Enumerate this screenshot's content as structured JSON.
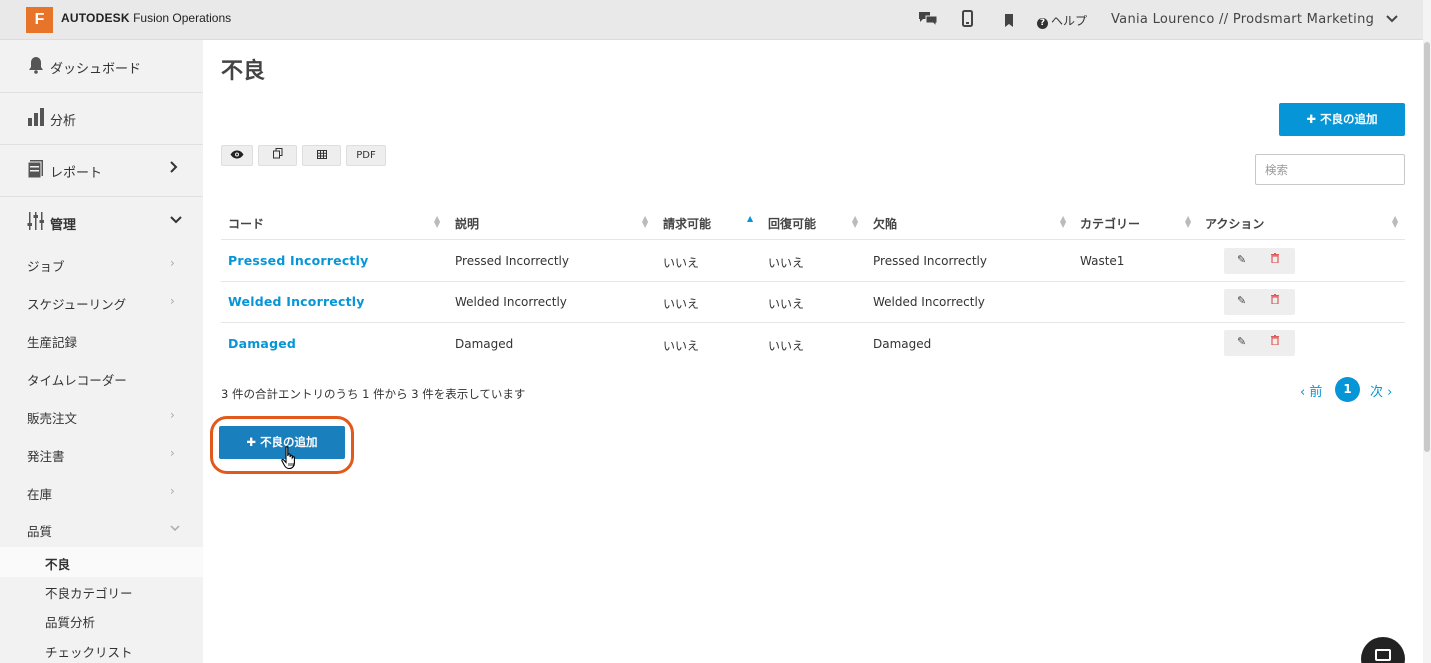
{
  "header": {
    "logo_letter": "F",
    "brand_bold": "AUTODESK",
    "brand_rest": " Fusion Operations",
    "help_label": "ヘルプ",
    "user_label": "Vania Lourenco // Prodsmart Marketing",
    "icons": [
      "chat-icon",
      "mobile-icon",
      "bookmark-icon",
      "help-icon",
      "chevron-down-icon"
    ]
  },
  "sidebar": {
    "main": [
      {
        "label": "ダッシュボード",
        "icon": "bell-icon"
      },
      {
        "label": "分析",
        "icon": "bar-chart-icon"
      },
      {
        "label": "レポート",
        "icon": "report-icon"
      },
      {
        "label": "管理",
        "icon": "sliders-icon"
      }
    ],
    "admin_items": [
      {
        "label": "ジョブ"
      },
      {
        "label": "スケジューリング"
      },
      {
        "label": "生産記録"
      },
      {
        "label": "タイムレコーダー"
      },
      {
        "label": "販売注文"
      },
      {
        "label": "発注書"
      },
      {
        "label": "在庫"
      },
      {
        "label": "品質"
      }
    ],
    "quality_sub": [
      {
        "label": "不良"
      },
      {
        "label": "不良カテゴリー"
      },
      {
        "label": "品質分析"
      },
      {
        "label": "チェックリスト"
      }
    ]
  },
  "page": {
    "title": "不良",
    "add_button": "不良の追加",
    "search_placeholder": "検索",
    "tools": {
      "view": "eye-icon",
      "copy": "copy-icon",
      "excel": "table-icon",
      "pdf": "PDF"
    }
  },
  "table": {
    "headers": [
      "コード",
      "説明",
      "請求可能",
      "回復可能",
      "欠陥",
      "カテゴリー",
      "アクション"
    ],
    "rows": [
      {
        "code": "Pressed Incorrectly",
        "description": "Pressed Incorrectly",
        "billable": "いいえ",
        "recoverable": "いいえ",
        "defect": "Pressed Incorrectly",
        "category": "Waste1"
      },
      {
        "code": "Welded Incorrectly",
        "description": "Welded Incorrectly",
        "billable": "いいえ",
        "recoverable": "いいえ",
        "defect": "Welded Incorrectly",
        "category": ""
      },
      {
        "code": "Damaged",
        "description": "Damaged",
        "billable": "いいえ",
        "recoverable": "いいえ",
        "defect": "Damaged",
        "category": ""
      }
    ]
  },
  "footer": {
    "info": "3 件の合計エントリのうち 1 件から 3 件を表示しています",
    "prev": "前",
    "page": "1",
    "next": "次"
  },
  "colors": {
    "accent": "#0696d7",
    "brand": "#e8742a",
    "highlight": "#e15a1c"
  }
}
